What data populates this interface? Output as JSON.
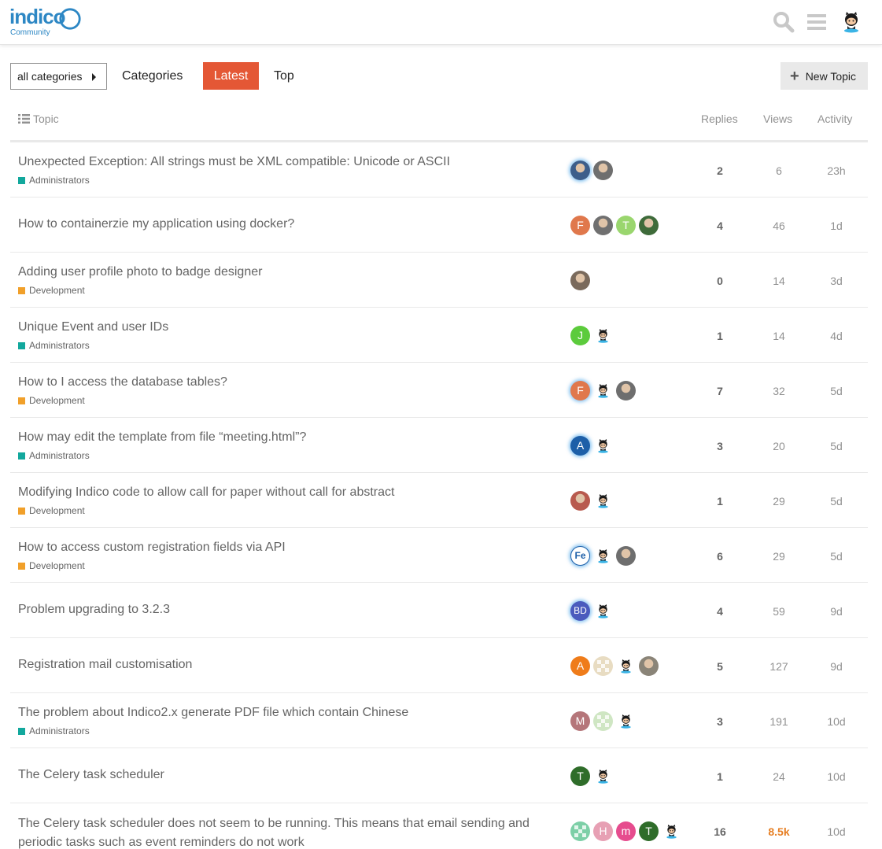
{
  "brand": {
    "logo_text": "indico",
    "logo_sub": "Community",
    "accent": "#e45735"
  },
  "header": {
    "search_icon": "search-icon",
    "menu_icon": "hamburger-menu-icon",
    "avatar_icon": "github-octocat-avatar"
  },
  "nav": {
    "category_dropdown": "all categories",
    "categories": "Categories",
    "latest": "Latest",
    "top": "Top",
    "new_topic": "New Topic"
  },
  "columns": {
    "topic": "Topic",
    "replies": "Replies",
    "views": "Views",
    "activity": "Activity"
  },
  "topics": [
    {
      "title": "Unexpected Exception: All strings must be XML compatible: Unicode or ASCII",
      "category": "Administrators",
      "category_color": "#12a89d",
      "posters": [
        {
          "kind": "photo",
          "color": "#3d5e8a",
          "ring": true
        },
        {
          "kind": "photo",
          "color": "#6e6e6e"
        }
      ],
      "replies": "2",
      "views": "6",
      "activity": "23h"
    },
    {
      "title": "How to containerzie my application using docker?",
      "category": "",
      "category_color": "",
      "posters": [
        {
          "kind": "letter",
          "letter": "F",
          "color": "#e0784c"
        },
        {
          "kind": "photo",
          "color": "#707070"
        },
        {
          "kind": "letter",
          "letter": "T",
          "color": "#9ad66e"
        },
        {
          "kind": "photo",
          "color": "#3e6b3a"
        }
      ],
      "replies": "4",
      "views": "46",
      "activity": "1d"
    },
    {
      "title": "Adding user profile photo to badge designer",
      "category": "Development",
      "category_color": "#f1a02a",
      "posters": [
        {
          "kind": "photo",
          "color": "#7a6a5c"
        }
      ],
      "replies": "0",
      "views": "14",
      "activity": "3d"
    },
    {
      "title": "Unique Event and user IDs",
      "category": "Administrators",
      "category_color": "#12a89d",
      "posters": [
        {
          "kind": "letter",
          "letter": "J",
          "color": "#5ccb3c"
        },
        {
          "kind": "octocat"
        }
      ],
      "replies": "1",
      "views": "14",
      "activity": "4d"
    },
    {
      "title": "How to I access the database tables?",
      "category": "Development",
      "category_color": "#f1a02a",
      "posters": [
        {
          "kind": "letter",
          "letter": "F",
          "color": "#e0784c",
          "ring": true
        },
        {
          "kind": "octocat"
        },
        {
          "kind": "photo",
          "color": "#6e6e6e"
        }
      ],
      "replies": "7",
      "views": "32",
      "activity": "5d"
    },
    {
      "title": "How may edit the template from file “meeting.html”?",
      "category": "Administrators",
      "category_color": "#12a89d",
      "posters": [
        {
          "kind": "letter",
          "letter": "A",
          "color": "#1d5fa8",
          "ring": true
        },
        {
          "kind": "octocat"
        }
      ],
      "replies": "3",
      "views": "20",
      "activity": "5d"
    },
    {
      "title": "Modifying Indico code to allow call for paper without call for abstract",
      "category": "Development",
      "category_color": "#f1a02a",
      "posters": [
        {
          "kind": "photo",
          "color": "#b85a4e"
        },
        {
          "kind": "octocat"
        }
      ],
      "replies": "1",
      "views": "29",
      "activity": "5d"
    },
    {
      "title": "How to access custom registration fields via API",
      "category": "Development",
      "category_color": "#f1a02a",
      "posters": [
        {
          "kind": "letter",
          "letter": "Fe",
          "color": "#ffffff",
          "text_color": "#1d5fa8",
          "ring": true
        },
        {
          "kind": "octocat"
        },
        {
          "kind": "photo",
          "color": "#6e6e6e"
        }
      ],
      "replies": "6",
      "views": "29",
      "activity": "5d"
    },
    {
      "title": "Problem upgrading to 3.2.3",
      "category": "",
      "category_color": "",
      "posters": [
        {
          "kind": "letter",
          "letter": "BD",
          "color": "#4a5bbd",
          "ring": true
        },
        {
          "kind": "octocat"
        }
      ],
      "replies": "4",
      "views": "59",
      "activity": "9d"
    },
    {
      "title": "Registration mail customisation",
      "category": "",
      "category_color": "",
      "posters": [
        {
          "kind": "letter",
          "letter": "A",
          "color": "#ef7c1a"
        },
        {
          "kind": "pattern",
          "color": "#e8dcc2"
        },
        {
          "kind": "octocat"
        },
        {
          "kind": "photo",
          "color": "#8a8478"
        }
      ],
      "replies": "5",
      "views": "127",
      "activity": "9d"
    },
    {
      "title": "The problem about Indico2.x generate PDF file which contain Chinese",
      "category": "Administrators",
      "category_color": "#12a89d",
      "posters": [
        {
          "kind": "letter",
          "letter": "M",
          "color": "#b5767a"
        },
        {
          "kind": "pattern",
          "color": "#cfe6c3"
        },
        {
          "kind": "octocat"
        }
      ],
      "replies": "3",
      "views": "191",
      "activity": "10d"
    },
    {
      "title": "The Celery task scheduler",
      "category": "",
      "category_color": "",
      "posters": [
        {
          "kind": "letter",
          "letter": "T",
          "color": "#2f6d2a"
        },
        {
          "kind": "octocat"
        }
      ],
      "replies": "1",
      "views": "24",
      "activity": "10d"
    },
    {
      "title": "The Celery task scheduler does not seem to be running. This means that email sending and periodic tasks such as event reminders do not work",
      "category": "",
      "category_color": "",
      "posters": [
        {
          "kind": "pattern",
          "color": "#7dcfa7"
        },
        {
          "kind": "letter",
          "letter": "H",
          "color": "#e7a0b4"
        },
        {
          "kind": "letter",
          "letter": "m",
          "color": "#e64c8e"
        },
        {
          "kind": "letter",
          "letter": "T",
          "color": "#2f6d2a"
        },
        {
          "kind": "octocat"
        }
      ],
      "replies": "16",
      "views": "8.5k",
      "views_hot": true,
      "activity": "10d"
    }
  ]
}
